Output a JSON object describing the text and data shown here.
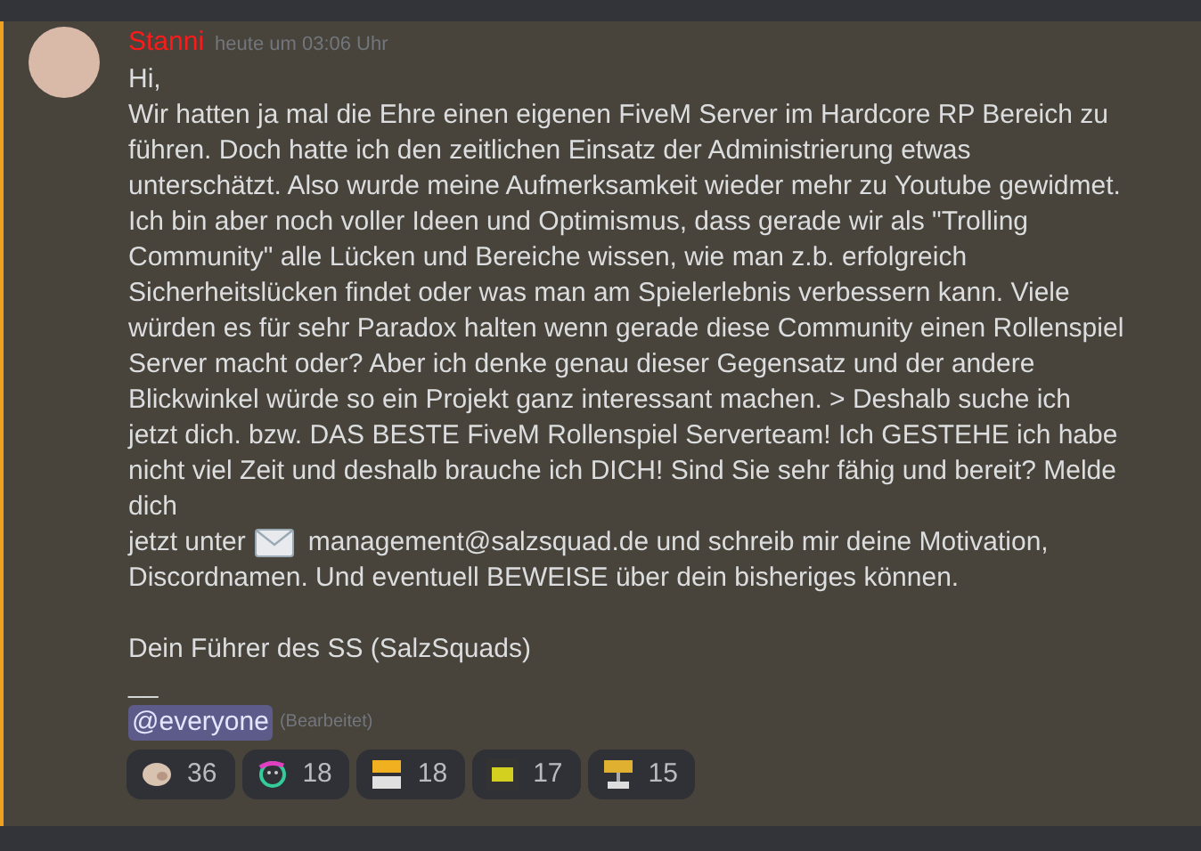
{
  "message": {
    "author": "Stanni",
    "timestamp": "heute um 03:06 Uhr",
    "greeting": "Hi,",
    "body_before_icon": "Wir hatten ja mal die Ehre einen eigenen FiveM Server im Hardcore RP Bereich zu führen. Doch hatte ich den zeitlichen Einsatz der Administrierung etwas unterschätzt. Also wurde meine Aufmerksamkeit wieder mehr zu Youtube gewidmet. Ich bin aber noch voller Ideen und Optimismus, dass gerade wir als \"Trolling Community\"  alle Lücken und Bereiche wissen, wie man z.b. erfolgreich Sicherheitslücken findet oder was man am Spielerlebnis verbessern kann. Viele würden es für sehr Paradox halten wenn gerade diese Community einen Rollenspiel Server macht oder? Aber ich denke genau dieser Gegensatz und der andere Blickwinkel würde so ein Projekt ganz interessant machen. > Deshalb suche ich jetzt dich. bzw. DAS BESTE FiveM Rollenspiel Serverteam! Ich GESTEHE ich habe nicht viel Zeit und deshalb brauche ich DICH! Sind Sie sehr fähig und bereit? Melde dich",
    "contact_lead": "jetzt unter",
    "email_line": "management@salzsquad.de und schreib mir deine Motivation,",
    "body_end": "Discordnamen. Und eventuell BEWEISE über dein bisheriges können.",
    "signature": "Dein Führer des SS (SalzSquads)",
    "separator": "__",
    "mention": "@everyone",
    "edited": "(Bearbeitet)"
  },
  "reactions": [
    {
      "kind": "face",
      "count": "36"
    },
    {
      "kind": "smiley",
      "count": "18"
    },
    {
      "kind": "army",
      "count": "18"
    },
    {
      "kind": "ss",
      "count": "17"
    },
    {
      "kind": "sign",
      "count": "15"
    }
  ]
}
